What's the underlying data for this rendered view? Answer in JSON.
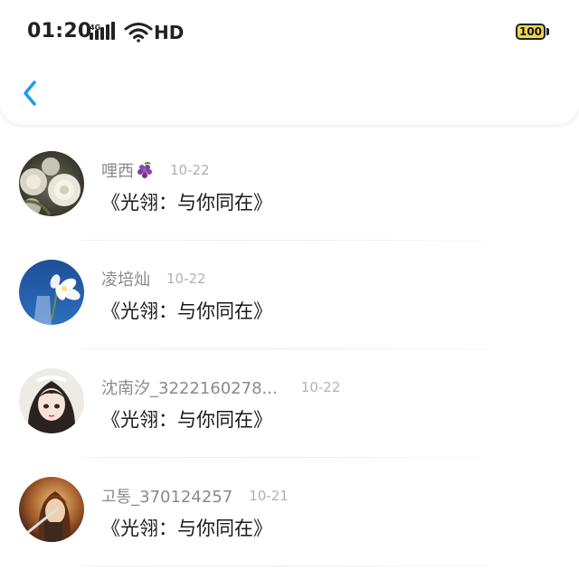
{
  "status_bar": {
    "time": "01:20",
    "network": "4G",
    "hd": "HD",
    "battery": "100"
  },
  "header": {
    "back_icon": "chevron-left-icon"
  },
  "colors": {
    "accent": "#1e9bf0",
    "battery_fill": "#f2d64b",
    "username": "#8a8a8a",
    "date": "#b2b2b2",
    "title": "#1a1a1a"
  },
  "items": [
    {
      "username": "哩西",
      "badge": "grape-icon",
      "date": "10-22",
      "title": "《光翎：与你同在》",
      "avatar": "white-roses-avatar"
    },
    {
      "username": "凌培灿",
      "date": "10-22",
      "title": "《光翎：与你同在》",
      "avatar": "white-flower-blue-sky-avatar"
    },
    {
      "username": "沈南汐_3222160278...",
      "date": "10-22",
      "title": "《光翎：与你同在》",
      "avatar": "anime-girl-avatar"
    },
    {
      "username": "고통_370124257",
      "date": "10-21",
      "title": "《光翎：与你同在》",
      "avatar": "warrior-avatar"
    }
  ]
}
